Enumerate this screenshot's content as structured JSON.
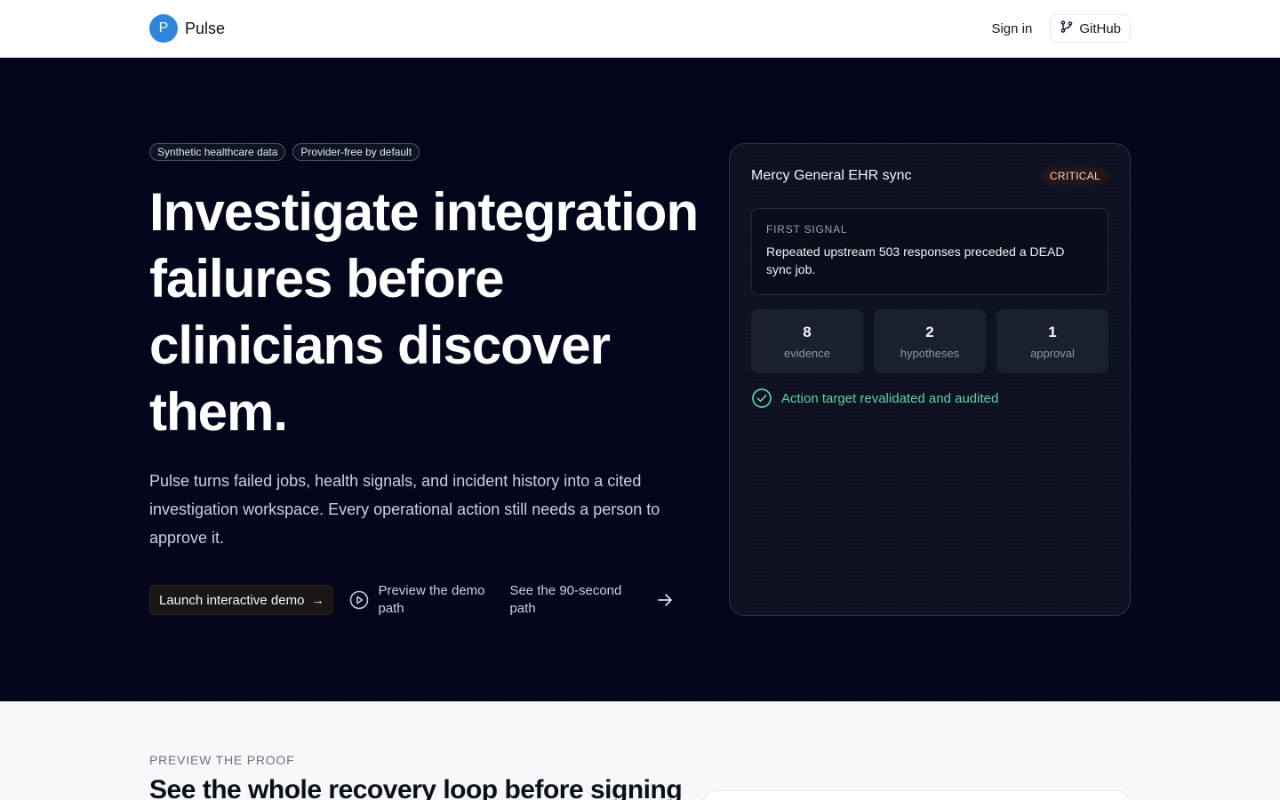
{
  "brand": {
    "logo_letter": "P",
    "name": "Pulse",
    "logo_color": "#2f86d8"
  },
  "nav": {
    "sign_in": "Sign in",
    "github": "GitHub"
  },
  "hero": {
    "chips": [
      "Synthetic healthcare data",
      "Provider-free by default"
    ],
    "title": "Investigate integration failures before clinicians discover them.",
    "subtitle": "Pulse turns failed jobs, health signals, and incident history into a cited investigation workspace. Every operational action still needs a person to approve it.",
    "cta_primary": "Launch interactive demo",
    "cta_preview": "Preview the demo path",
    "cta_see": "See the 90-second path"
  },
  "incident_card": {
    "title": "Mercy General EHR sync",
    "severity": "CRITICAL",
    "signal_label": "FIRST SIGNAL",
    "signal_text": "Repeated upstream 503 responses preceded a DEAD sync job.",
    "stats": [
      {
        "value": "8",
        "label": "evidence"
      },
      {
        "value": "2",
        "label": "hypotheses"
      },
      {
        "value": "1",
        "label": "approval"
      }
    ],
    "audit_status": "Action target revalidated and audited",
    "audit_color": "#5fd3a3"
  },
  "proof": {
    "kicker": "PREVIEW THE PROOF",
    "title": "See the whole recovery loop before signing"
  },
  "colors": {
    "hero_bg": "#02051a",
    "accent": "#2f86d8",
    "critical_text": "#f6d0c7"
  }
}
